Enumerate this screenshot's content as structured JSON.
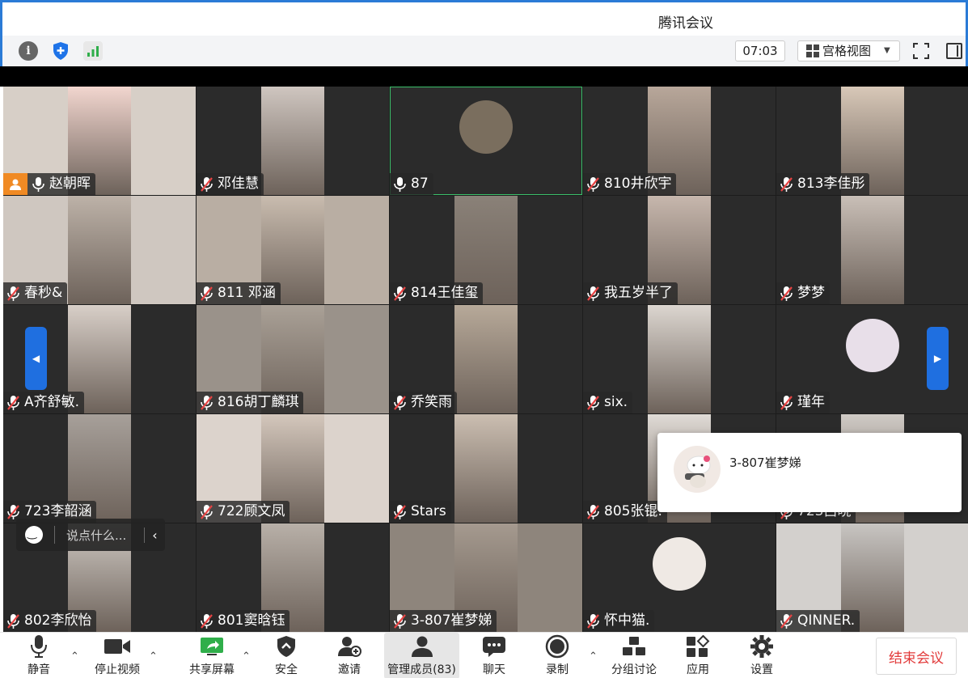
{
  "window": {
    "title": "腾讯会议"
  },
  "infobar": {
    "timer": "07:03",
    "view_label": "宫格视图"
  },
  "participants": [
    {
      "name": "赵朝晖",
      "muted": false,
      "host": true,
      "bg": "#d7cfc7",
      "vid": "#f2d6cf"
    },
    {
      "name": "邓佳慧",
      "muted": true,
      "bg": "#2b2b2b",
      "vid": "#cfc6c0"
    },
    {
      "name": "87",
      "muted": false,
      "active": true,
      "bg": "#2b2b2b",
      "avatar": "#7a6e5e"
    },
    {
      "name": "810井欣宇",
      "muted": true,
      "bg": "#2b2b2b",
      "vid": "#b8a79a"
    },
    {
      "name": "813李佳彤",
      "muted": true,
      "bg": "#2b2b2b",
      "vid": "#d8c8b8"
    },
    {
      "name": "春秒&",
      "muted": true,
      "bg": "#cfc7c0",
      "vid": "#bdb2a8"
    },
    {
      "name": "811    邓涵",
      "muted": true,
      "bg": "#b9aea3",
      "vid": "#c9bcaf"
    },
    {
      "name": "814王佳玺",
      "muted": true,
      "bg": "#2b2b2b",
      "vid": "#8a8178"
    },
    {
      "name": "我五岁半了",
      "muted": true,
      "bg": "#2b2b2b",
      "vid": "#c7b7ad"
    },
    {
      "name": "梦梦",
      "muted": true,
      "bg": "#2b2b2b",
      "vid": "#c9bfb7"
    },
    {
      "name": "A齐舒敏.",
      "muted": true,
      "bg": "#2b2b2b",
      "vid": "#d8cfc8"
    },
    {
      "name": "816胡丁麟琪",
      "muted": true,
      "bg": "#9a928a",
      "vid": "#aaa197"
    },
    {
      "name": "乔笑雨",
      "muted": true,
      "bg": "#2b2b2b",
      "vid": "#b7a999"
    },
    {
      "name": "six.",
      "muted": true,
      "bg": "#2b2b2b",
      "vid": "#dcd6d0"
    },
    {
      "name": "瑾年",
      "muted": true,
      "bg": "#2b2b2b",
      "avatar": "#e8dfe9"
    },
    {
      "name": "723李韶涵",
      "muted": true,
      "bg": "#2b2b2b",
      "vid": "#a7a09a"
    },
    {
      "name": "722顾文凤",
      "muted": true,
      "bg": "#dcd3cc",
      "vid": "#d4c7bc"
    },
    {
      "name": "Stars",
      "muted": true,
      "bg": "#2b2b2b",
      "vid": "#cbbeb1"
    },
    {
      "name": "805张锟.",
      "muted": true,
      "bg": "#2b2b2b",
      "vid": "#e0dbd6"
    },
    {
      "name": "723吕晓",
      "muted": true,
      "bg": "#2b2b2b",
      "vid": "#cfcac5"
    },
    {
      "name": "802李欣怡",
      "muted": true,
      "bg": "#2b2b2b",
      "vid": "#cfc9c3"
    },
    {
      "name": "801窦晗钰",
      "muted": true,
      "bg": "#2b2b2b",
      "vid": "#b8b0a8"
    },
    {
      "name": "3-807崔梦娣",
      "muted": true,
      "bg": "#8e857c",
      "vid": "#a59a8f"
    },
    {
      "name": "怀中猫.",
      "muted": true,
      "bg": "#2b2b2b",
      "avatar": "#efe9e4"
    },
    {
      "name": "QINNER.",
      "muted": true,
      "bg": "#d3d0cd",
      "vid": "#c8c5c2"
    }
  ],
  "quickchat": {
    "placeholder": "说点什么..."
  },
  "popup": {
    "name": "3-807崔梦娣"
  },
  "toolbar": {
    "mute": "静音",
    "stop_video": "停止视频",
    "share_screen": "共享屏幕",
    "security": "安全",
    "invite": "邀请",
    "manage_members": "管理成员(83)",
    "chat": "聊天",
    "record": "录制",
    "breakout": "分组讨论",
    "apps": "应用",
    "settings": "设置",
    "end_meeting": "结束会议"
  },
  "colors": {
    "accent": "#1f6fe0",
    "end": "#e23b3b",
    "host": "#f08a24",
    "active_outline": "#3bbf6a"
  }
}
